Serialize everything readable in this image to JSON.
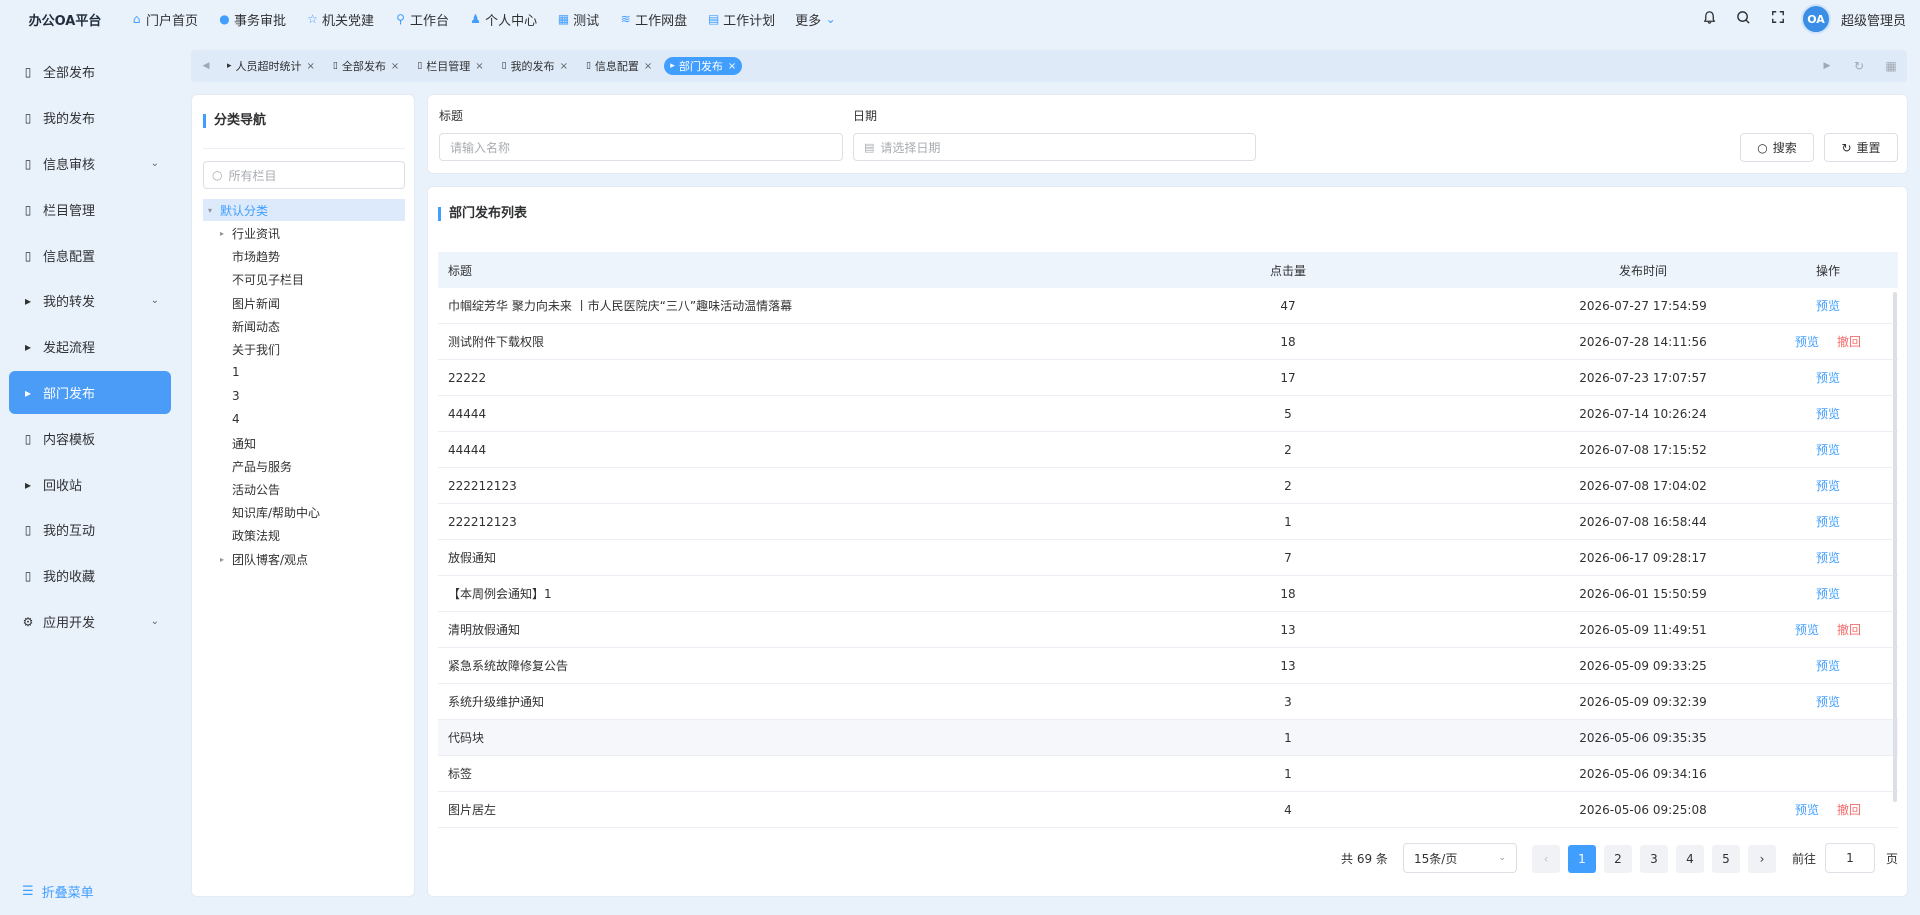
{
  "brand": "办公OA平台",
  "topnav": [
    {
      "label": "门户首页",
      "icon": "home-icon"
    },
    {
      "label": "事务审批",
      "icon": "info-icon"
    },
    {
      "label": "机关党建",
      "icon": "star-icon"
    },
    {
      "label": "工作台",
      "icon": "workflow-icon"
    },
    {
      "label": "个人中心",
      "icon": "user-icon"
    },
    {
      "label": "测试",
      "icon": "grid-icon"
    },
    {
      "label": "工作网盘",
      "icon": "database-icon"
    },
    {
      "label": "工作计划",
      "icon": "calendar-icon"
    },
    {
      "label": "更多",
      "icon": "chevron-down-icon"
    }
  ],
  "user": {
    "avatar_text": "OA",
    "name": "超级管理员"
  },
  "sidebar": {
    "items": [
      {
        "label": "全部发布",
        "icon": "document-icon"
      },
      {
        "label": "我的发布",
        "icon": "document-icon"
      },
      {
        "label": "信息审核",
        "icon": "document-icon"
      },
      {
        "label": "栏目管理",
        "icon": "document-icon"
      },
      {
        "label": "信息配置",
        "icon": "document-icon"
      },
      {
        "label": "我的转发",
        "icon": "caret-right-icon"
      },
      {
        "label": "发起流程",
        "icon": "caret-right-icon"
      },
      {
        "label": "部门发布",
        "icon": "caret-right-icon"
      },
      {
        "label": "内容模板",
        "icon": "document-icon"
      },
      {
        "label": "回收站",
        "icon": "caret-right-icon"
      },
      {
        "label": "我的互动",
        "icon": "document-icon"
      },
      {
        "label": "我的收藏",
        "icon": "document-icon"
      },
      {
        "label": "应用开发",
        "icon": "gear-icon"
      }
    ],
    "collapse_label": "折叠菜单"
  },
  "tabs": [
    {
      "label": "人员超时统计"
    },
    {
      "label": "全部发布"
    },
    {
      "label": "栏目管理"
    },
    {
      "label": "我的发布"
    },
    {
      "label": "信息配置"
    },
    {
      "label": "部门发布"
    }
  ],
  "tree": {
    "title": "分类导航",
    "search_placeholder": "所有栏目",
    "root": "默认分类",
    "nodes": [
      "行业资讯",
      "市场趋势",
      "不可见子栏目",
      "图片新闻",
      "新闻动态",
      "关于我们",
      "1",
      "3",
      "4",
      "通知",
      "产品与服务",
      "活动公告",
      "知识库/帮助中心",
      "政策法规",
      "团队博客/观点"
    ]
  },
  "filter": {
    "title_label": "标题",
    "title_placeholder": "请输入名称",
    "date_label": "日期",
    "date_placeholder": "请选择日期",
    "search_button": "搜索",
    "reset_button": "重置"
  },
  "list": {
    "title": "部门发布列表",
    "headers": {
      "title": "标题",
      "hits": "点击量",
      "time": "发布时间",
      "op": "操作"
    },
    "preview_label": "预览",
    "revoke_label": "撤回",
    "rows": [
      {
        "title": "巾帼绽芳华 聚力向未来 丨市人民医院庆“三八”趣味活动温情落幕",
        "hits": "47",
        "time": "2026-07-27 17:54:59",
        "ops": "preview"
      },
      {
        "title": "测试附件下载权限",
        "hits": "18",
        "time": "2026-07-28 14:11:56",
        "ops": "both"
      },
      {
        "title": "22222",
        "hits": "17",
        "time": "2026-07-23 17:07:57",
        "ops": "preview"
      },
      {
        "title": "44444",
        "hits": "5",
        "time": "2026-07-14 10:26:24",
        "ops": "preview"
      },
      {
        "title": "44444",
        "hits": "2",
        "time": "2026-07-08 17:15:52",
        "ops": "preview"
      },
      {
        "title": "222212123",
        "hits": "2",
        "time": "2026-07-08 17:04:02",
        "ops": "preview"
      },
      {
        "title": "222212123",
        "hits": "1",
        "time": "2026-07-08 16:58:44",
        "ops": "preview"
      },
      {
        "title": "放假通知",
        "hits": "7",
        "time": "2026-06-17 09:28:17",
        "ops": "preview"
      },
      {
        "title": "【本周例会通知】1",
        "hits": "18",
        "time": "2026-06-01 15:50:59",
        "ops": "preview"
      },
      {
        "title": "清明放假通知",
        "hits": "13",
        "time": "2026-05-09 11:49:51",
        "ops": "both"
      },
      {
        "title": "紧急系统故障修复公告",
        "hits": "13",
        "time": "2026-05-09 09:33:25",
        "ops": "preview"
      },
      {
        "title": "系统升级维护通知",
        "hits": "3",
        "time": "2026-05-09 09:32:39",
        "ops": "preview"
      },
      {
        "title": "代码块",
        "hits": "1",
        "time": "2026-05-06 09:35:35",
        "ops": "none"
      },
      {
        "title": "标签",
        "hits": "1",
        "time": "2026-05-06 09:34:16",
        "ops": "none"
      },
      {
        "title": "图片居左",
        "hits": "4",
        "time": "2026-05-06 09:25:08",
        "ops": "both"
      }
    ]
  },
  "pagination": {
    "total": "共 69 条",
    "page_size": "15条/页",
    "pages": [
      "1",
      "2",
      "3",
      "4",
      "5"
    ],
    "current": "1",
    "goto_label": "前往",
    "goto_value": "1",
    "page_suffix": "页"
  },
  "colors": {
    "accent": "#409eff",
    "danger": "#f56c6c",
    "background": "#e9f1fb"
  }
}
